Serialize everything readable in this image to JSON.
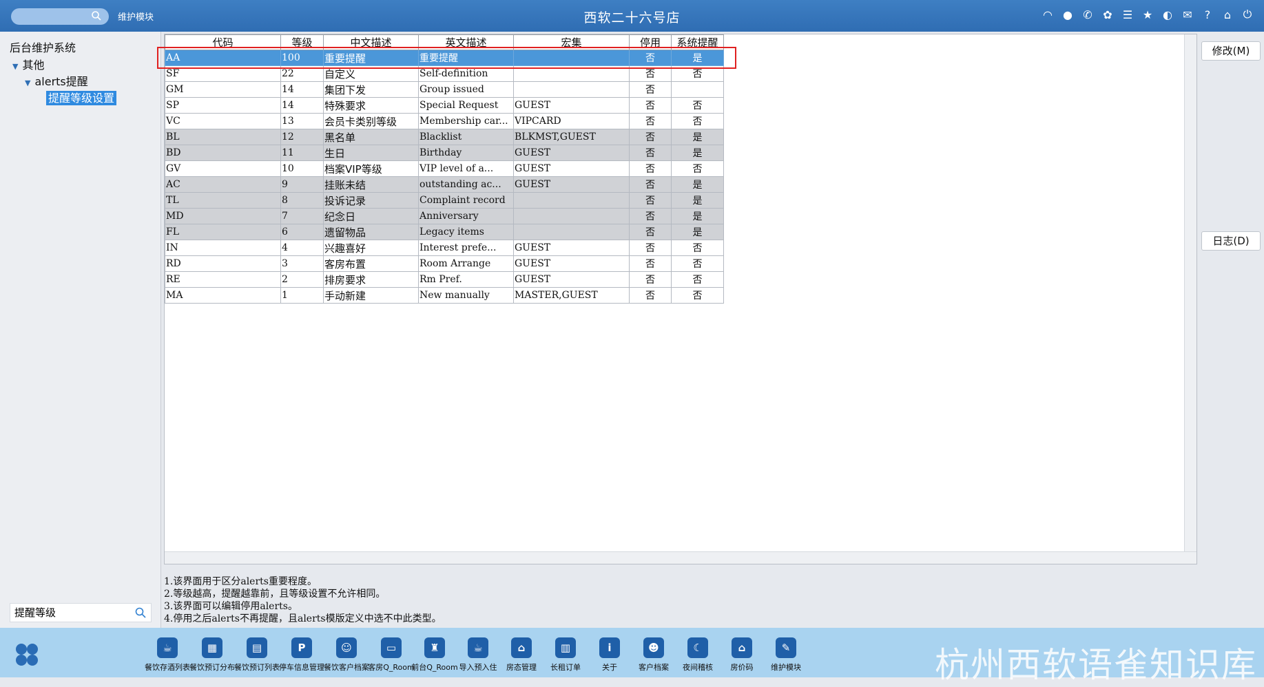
{
  "topbar": {
    "module_label": "维护模块",
    "title": "西软二十六号店",
    "icons": [
      "wifi-icon",
      "chat-icon",
      "phone-icon",
      "palette-icon",
      "menu-icon",
      "star-icon",
      "contrast-icon",
      "mail-icon",
      "help-icon",
      "home-icon",
      "power-icon"
    ]
  },
  "tree": {
    "root": "后台维护系统",
    "level1": "其他",
    "level2": "alerts提醒",
    "selected": "提醒等级设置"
  },
  "left_search": {
    "value": "提醒等级"
  },
  "table": {
    "headers": [
      "代码",
      "等级",
      "中文描述",
      "英文描述",
      "宏集",
      "停用",
      "系统提醒"
    ],
    "rows": [
      {
        "code": "AA",
        "level": "100",
        "cn": "重要提醒",
        "en": "重要提醒",
        "macro": "",
        "disabled": "否",
        "sys": "是",
        "style": "sel"
      },
      {
        "code": "SF",
        "level": "22",
        "cn": "自定义",
        "en": "Self-definition",
        "macro": "",
        "disabled": "否",
        "sys": "否",
        "style": ""
      },
      {
        "code": "GM",
        "level": "14",
        "cn": "集团下发",
        "en": "Group issued",
        "macro": "",
        "disabled": "否",
        "sys": "",
        "style": ""
      },
      {
        "code": "SP",
        "level": "14",
        "cn": "特殊要求",
        "en": "Special Request",
        "macro": "GUEST",
        "disabled": "否",
        "sys": "否",
        "style": ""
      },
      {
        "code": "VC",
        "level": "13",
        "cn": "会员卡类别等级",
        "en": "Membership car...",
        "macro": "VIPCARD",
        "disabled": "否",
        "sys": "否",
        "style": ""
      },
      {
        "code": "BL",
        "level": "12",
        "cn": "黑名单",
        "en": "Blacklist",
        "macro": "BLKMST,GUEST",
        "disabled": "否",
        "sys": "是",
        "style": "gray"
      },
      {
        "code": "BD",
        "level": "11",
        "cn": "生日",
        "en": "Birthday",
        "macro": "GUEST",
        "disabled": "否",
        "sys": "是",
        "style": "gray"
      },
      {
        "code": "GV",
        "level": "10",
        "cn": "档案VIP等级",
        "en": "VIP level of a...",
        "macro": "GUEST",
        "disabled": "否",
        "sys": "否",
        "style": ""
      },
      {
        "code": "AC",
        "level": "9",
        "cn": "挂账未结",
        "en": "outstanding ac...",
        "macro": "GUEST",
        "disabled": "否",
        "sys": "是",
        "style": "gray"
      },
      {
        "code": "TL",
        "level": "8",
        "cn": "投诉记录",
        "en": "Complaint record",
        "macro": "",
        "disabled": "否",
        "sys": "是",
        "style": "gray"
      },
      {
        "code": "MD",
        "level": "7",
        "cn": "纪念日",
        "en": "Anniversary",
        "macro": "",
        "disabled": "否",
        "sys": "是",
        "style": "gray"
      },
      {
        "code": "FL",
        "level": "6",
        "cn": "遗留物品",
        "en": "Legacy items",
        "macro": "",
        "disabled": "否",
        "sys": "是",
        "style": "gray"
      },
      {
        "code": "IN",
        "level": "4",
        "cn": "兴趣喜好",
        "en": "Interest prefe...",
        "macro": "GUEST",
        "disabled": "否",
        "sys": "否",
        "style": ""
      },
      {
        "code": "RD",
        "level": "3",
        "cn": "客房布置",
        "en": "Room Arrange",
        "macro": "GUEST",
        "disabled": "否",
        "sys": "否",
        "style": ""
      },
      {
        "code": "RE",
        "level": "2",
        "cn": "排房要求",
        "en": "Rm Pref.",
        "macro": "GUEST",
        "disabled": "否",
        "sys": "否",
        "style": ""
      },
      {
        "code": "MA",
        "level": "1",
        "cn": "手动新建",
        "en": "New manually",
        "macro": "MASTER,GUEST",
        "disabled": "否",
        "sys": "否",
        "style": ""
      }
    ]
  },
  "buttons": {
    "modify": "修改(M)",
    "log": "日志(D)"
  },
  "notes": [
    "1.该界面用于区分alerts重要程度。",
    "2.等级越高，提醒越靠前，且等级设置不允许相同。",
    "3.该界面可以编辑停用alerts。",
    "4.停用之后alerts不再提醒，且alerts模版定义中选不中此类型。"
  ],
  "dock": [
    {
      "label": "餐饮存酒列表",
      "glyph": "☕"
    },
    {
      "label": "餐饮预订分布",
      "glyph": "▦"
    },
    {
      "label": "餐饮预订列表",
      "glyph": "▤"
    },
    {
      "label": "停车信息管理",
      "glyph": "P"
    },
    {
      "label": "餐饮客户档案",
      "glyph": "☺"
    },
    {
      "label": "客房Q_Room",
      "glyph": "▭"
    },
    {
      "label": "前台Q_Room",
      "glyph": "♜"
    },
    {
      "label": "导入预入住",
      "glyph": "☕"
    },
    {
      "label": "房态管理",
      "glyph": "⌂"
    },
    {
      "label": "长租订单",
      "glyph": "▥"
    },
    {
      "label": "关于",
      "glyph": "i"
    },
    {
      "label": "客户档案",
      "glyph": "☻"
    },
    {
      "label": "夜间稽核",
      "glyph": "☾"
    },
    {
      "label": "房价码",
      "glyph": "⌂"
    },
    {
      "label": "维护模块",
      "glyph": "✎"
    }
  ],
  "watermark": "杭州西软语雀知识库"
}
